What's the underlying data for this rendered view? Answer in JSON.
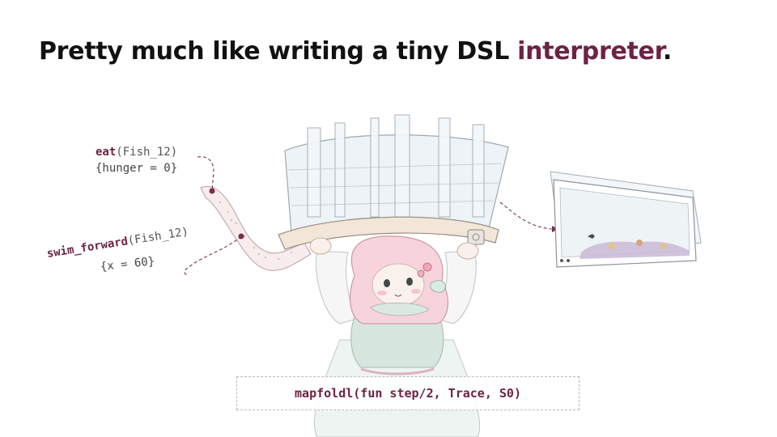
{
  "title": {
    "main": "Pretty much like writing a tiny DSL ",
    "accent": "interpreter",
    "end": "."
  },
  "trace": [
    {
      "fn": "eat",
      "args": "(Fish_12)",
      "state": "{hunger = 0}"
    },
    {
      "fn": "swim_forward",
      "args": "(Fish_12)",
      "state": "{x = 60}"
    }
  ],
  "code": "mapfoldl(fun step/2, Trace, S0)",
  "colors": {
    "accent": "#6e2243",
    "text": "#111111",
    "muted": "#555555"
  },
  "illustration": {
    "character": "girl-holding-fish-tank-icon",
    "screen": "aquarium-window-icon"
  }
}
